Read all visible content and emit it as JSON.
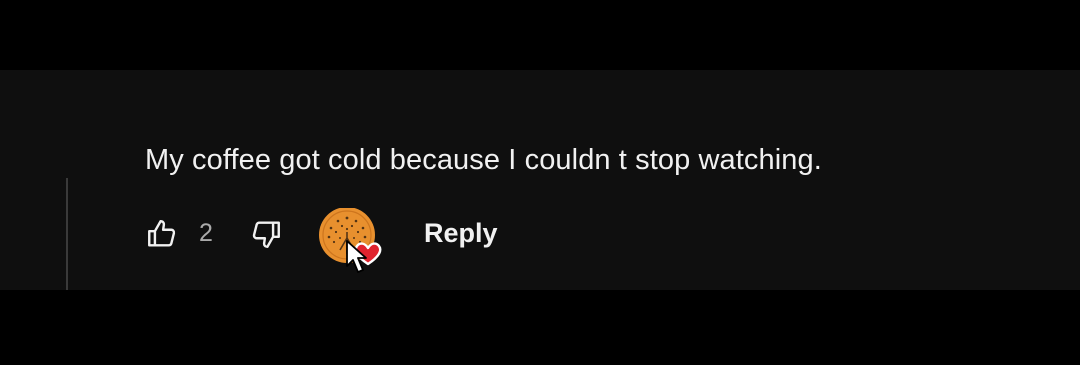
{
  "comment": {
    "text": "My coffee got cold because I couldn t stop watching."
  },
  "actions": {
    "like_icon": "thumbs-up-icon",
    "like_count": "2",
    "dislike_icon": "thumbs-down-icon",
    "heart_icon": "creator-heart-icon",
    "reply_label": "Reply"
  },
  "colors": {
    "background": "#0f0f0f",
    "text": "#f1f1f1",
    "muted_text": "#aaaaaa",
    "avatar": "#e8902e",
    "heart": "#e0232e"
  }
}
